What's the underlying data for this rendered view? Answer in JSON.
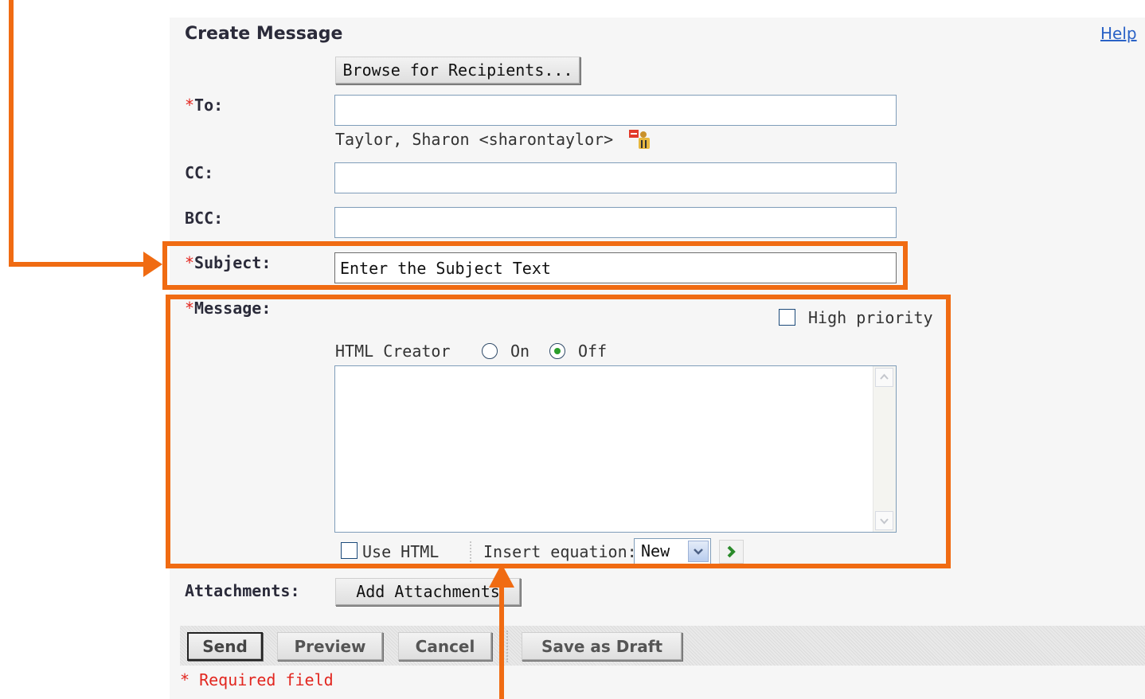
{
  "header": {
    "title": "Create Message",
    "help_label": "Help"
  },
  "recipients": {
    "browse_button": "Browse for Recipients...",
    "to_label": "To:",
    "to_value": "",
    "to_recipient": "Taylor, Sharon <sharontaylor>",
    "cc_label": "CC:",
    "cc_value": "",
    "bcc_label": "BCC:",
    "bcc_value": ""
  },
  "subject": {
    "label": "Subject:",
    "value": "Enter the Subject Text"
  },
  "message": {
    "label": "Message:",
    "high_priority_label": "High priority",
    "html_creator_label": "HTML Creator",
    "on_label": "On",
    "off_label": "Off",
    "html_creator_selected": "Off",
    "body_value": "",
    "use_html_label": "Use HTML",
    "insert_equation_label": "Insert equation:",
    "equation_selected": "New"
  },
  "attachments": {
    "label": "Attachments:",
    "add_button": "Add Attachments"
  },
  "actions": {
    "send": "Send",
    "preview": "Preview",
    "cancel": "Cancel",
    "save_draft": "Save as Draft"
  },
  "required_note": "* Required field",
  "required_marker": "*",
  "colors": {
    "annotation": "#f06b12",
    "required": "#e2261f",
    "link": "#2a62c6"
  }
}
